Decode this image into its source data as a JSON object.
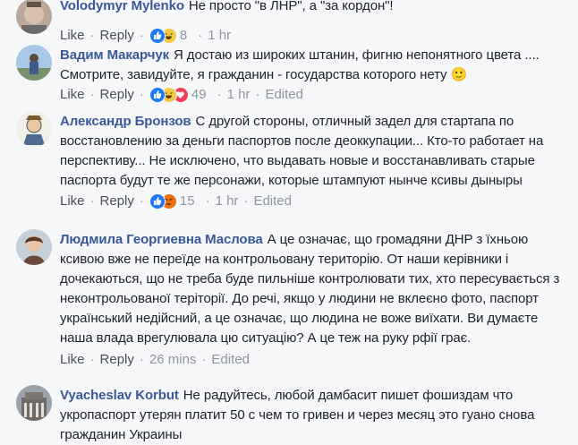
{
  "comments": [
    {
      "author": "Volodymyr Mylenko",
      "text": "Не просто \"в ЛНР\", а \"за кордон\"!",
      "like": "Like",
      "reply": "Reply",
      "reactions": [
        "like",
        "haha"
      ],
      "count": "8",
      "time": "1 hr",
      "edited": ""
    },
    {
      "author": "Вадим Макарчук",
      "text": "Я достаю из широких штанин, фигню непонятного цвета .... Смотрите, завидуйте, я гражданин - государства которого нету 🙂",
      "like": "Like",
      "reply": "Reply",
      "reactions": [
        "like",
        "haha",
        "love"
      ],
      "count": "49",
      "time": "1 hr",
      "edited": "Edited"
    },
    {
      "author": "Александр Бронзов",
      "text": "С другой стороны, отличный задел для стартапа по восстановлению за деньги паспортов после деоккупации... Кто-то работает на перспективу... Не исключено, что выдавать новые и восстанавливать старые паспорта будут те же персонажи, которые штампуют нынче ксивы дыныры",
      "like": "Like",
      "reply": "Reply",
      "reactions": [
        "like",
        "angry"
      ],
      "count": "15",
      "time": "1 hr",
      "edited": "Edited"
    },
    {
      "author": "Людмила Георгиевна Маслова",
      "text": "А це означає, що громадяни ДНР з їхньою ксивою вже не переїде на контрольовану територію. От наши керівники і дочекаються, що не треба буде пильніше контролювати тих, хто пересувається з неконтрольованої теріторії. До речі, якщо у людини не вклеєно фото, паспорт український недійсний, а це означає, що людина не воже виїхати. Ви думаєте наша влада врегулювала цю ситуацію? А це теж на руку рфії грає.",
      "like": "Like",
      "reply": "Reply",
      "reactions": [],
      "count": "",
      "time": "26 mins",
      "edited": "Edited"
    },
    {
      "author": "Vyacheslav Korbut",
      "text": "Не радуйтесь, любой дамбасит пишет фошиздам что укропаспорт утерян платит 50 с чем то гривен и через месяц это гуано снова гражданин Украины",
      "like": "",
      "reply": "",
      "reactions": [],
      "count": "",
      "time": "",
      "edited": ""
    }
  ],
  "colors": {
    "author": "#385898",
    "text": "#1d2129",
    "meta": "#90949c",
    "like_blue": "#2078f4",
    "haha_yellow": "#f7c843",
    "love_red": "#f33e58",
    "angry_orange": "#e9710f"
  }
}
